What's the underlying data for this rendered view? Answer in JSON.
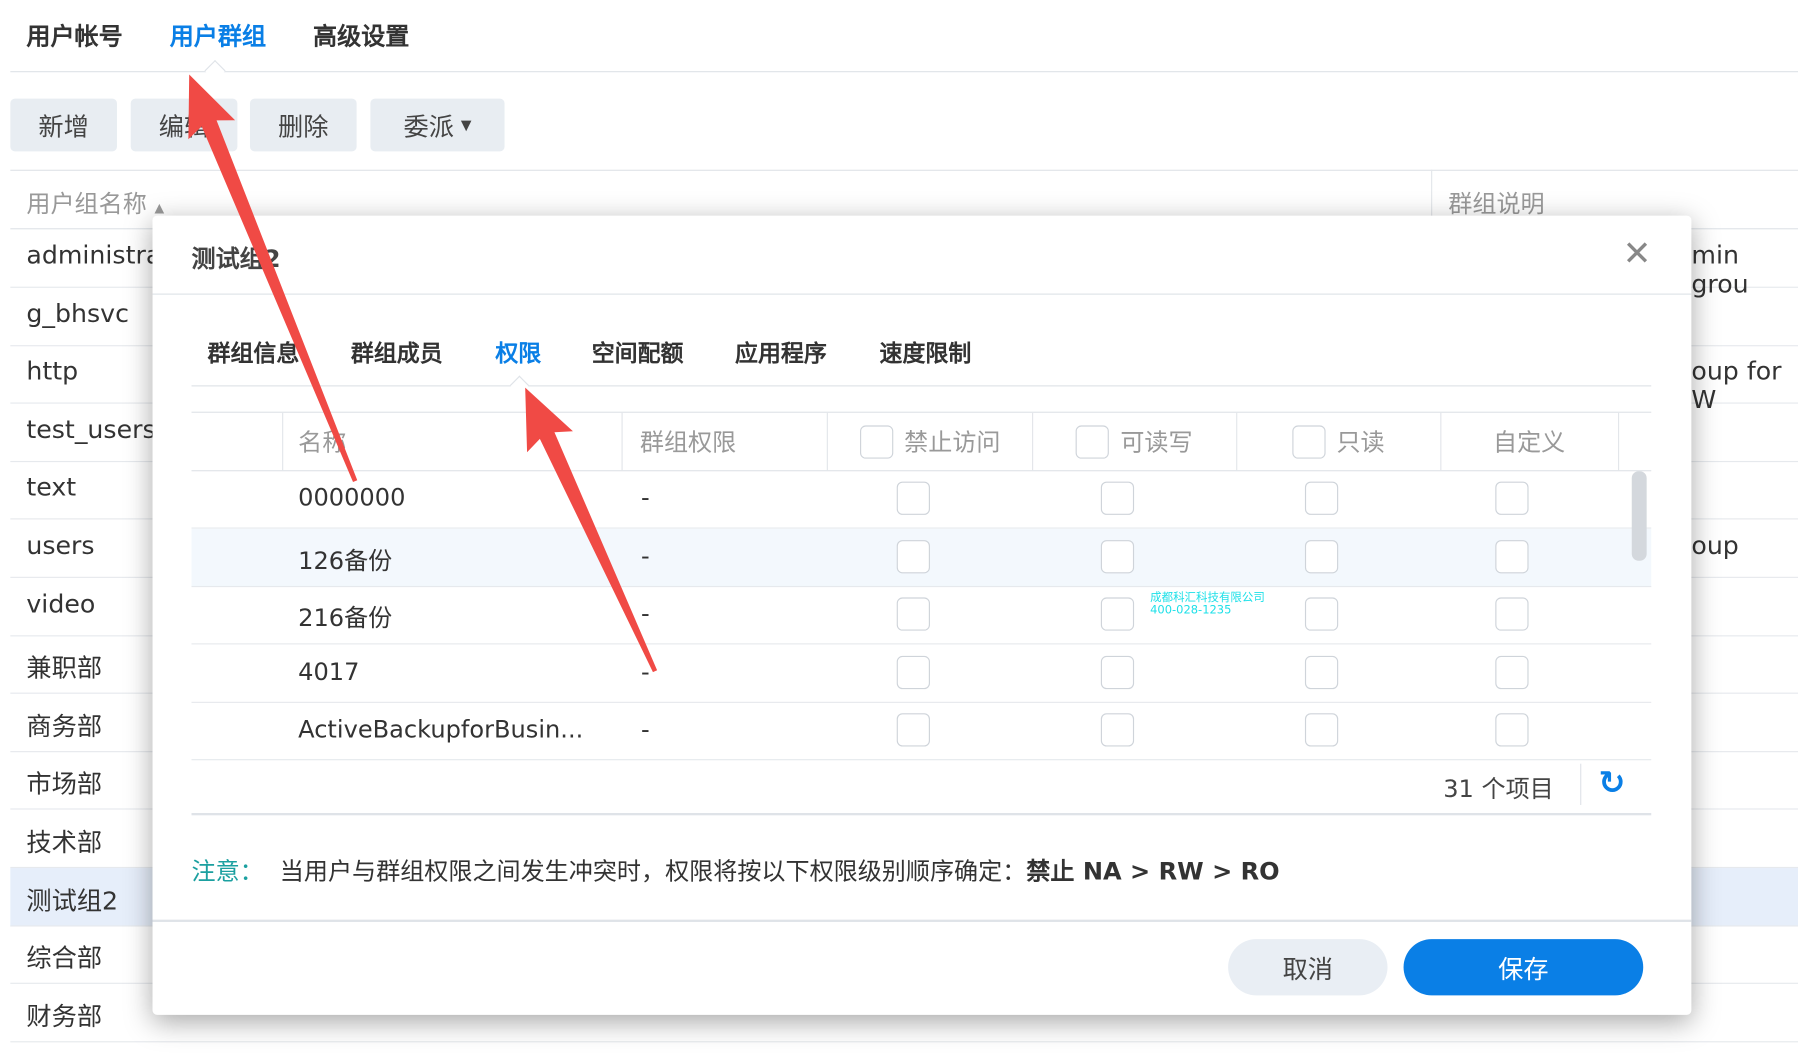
{
  "top_tabs": [
    {
      "label": "用户帐号"
    },
    {
      "label": "用户群组",
      "active": true
    },
    {
      "label": "高级设置"
    }
  ],
  "toolbar": {
    "add": "新增",
    "edit": "编辑",
    "delete": "删除",
    "delegate": "委派"
  },
  "list": {
    "col_name": "用户组名称",
    "col_desc": "群组说明",
    "rows": [
      {
        "name": "administrators",
        "desc": "min grou"
      },
      {
        "name": "g_bhsvc",
        "desc": ""
      },
      {
        "name": "http",
        "desc": "oup for W"
      },
      {
        "name": "test_users",
        "desc": ""
      },
      {
        "name": "text",
        "desc": ""
      },
      {
        "name": "users",
        "desc": "oup"
      },
      {
        "name": "video",
        "desc": ""
      },
      {
        "name": "兼职部",
        "desc": ""
      },
      {
        "name": "商务部",
        "desc": ""
      },
      {
        "name": "市场部",
        "desc": ""
      },
      {
        "name": "技术部",
        "desc": ""
      },
      {
        "name": "测试组2",
        "desc": "",
        "selected": true
      },
      {
        "name": "综合部",
        "desc": ""
      },
      {
        "name": "财务部",
        "desc": ""
      }
    ]
  },
  "modal": {
    "title": "测试组2",
    "tabs": [
      {
        "label": "群组信息"
      },
      {
        "label": "群组成员"
      },
      {
        "label": "权限",
        "active": true
      },
      {
        "label": "空间配额"
      },
      {
        "label": "应用程序"
      },
      {
        "label": "速度限制"
      }
    ],
    "grid": {
      "headers": {
        "name": "名称",
        "group_perm": "群组权限",
        "deny": "禁止访问",
        "rw": "可读写",
        "ro": "只读",
        "custom": "自定义"
      },
      "rows": [
        {
          "name": "0000000",
          "perm": "-"
        },
        {
          "name": "126备份",
          "perm": "-"
        },
        {
          "name": "216备份",
          "perm": "-"
        },
        {
          "name": "4017",
          "perm": "-"
        },
        {
          "name": "ActiveBackupforBusin...",
          "perm": "-"
        }
      ],
      "count": "31 个项目"
    },
    "note_label": "注意：",
    "note_text": "当用户与群组权限之间发生冲突时，权限将按以下权限级别顺序确定：",
    "note_bold": "禁止 NA > RW > RO",
    "cancel": "取消",
    "save": "保存"
  },
  "watermark": {
    "line1": "成都科汇科技有限公司",
    "line2": "400-028-1235"
  },
  "colors": {
    "accent": "#0a7fe6",
    "note": "#1ba0a0",
    "arrow": "#f04a45"
  }
}
